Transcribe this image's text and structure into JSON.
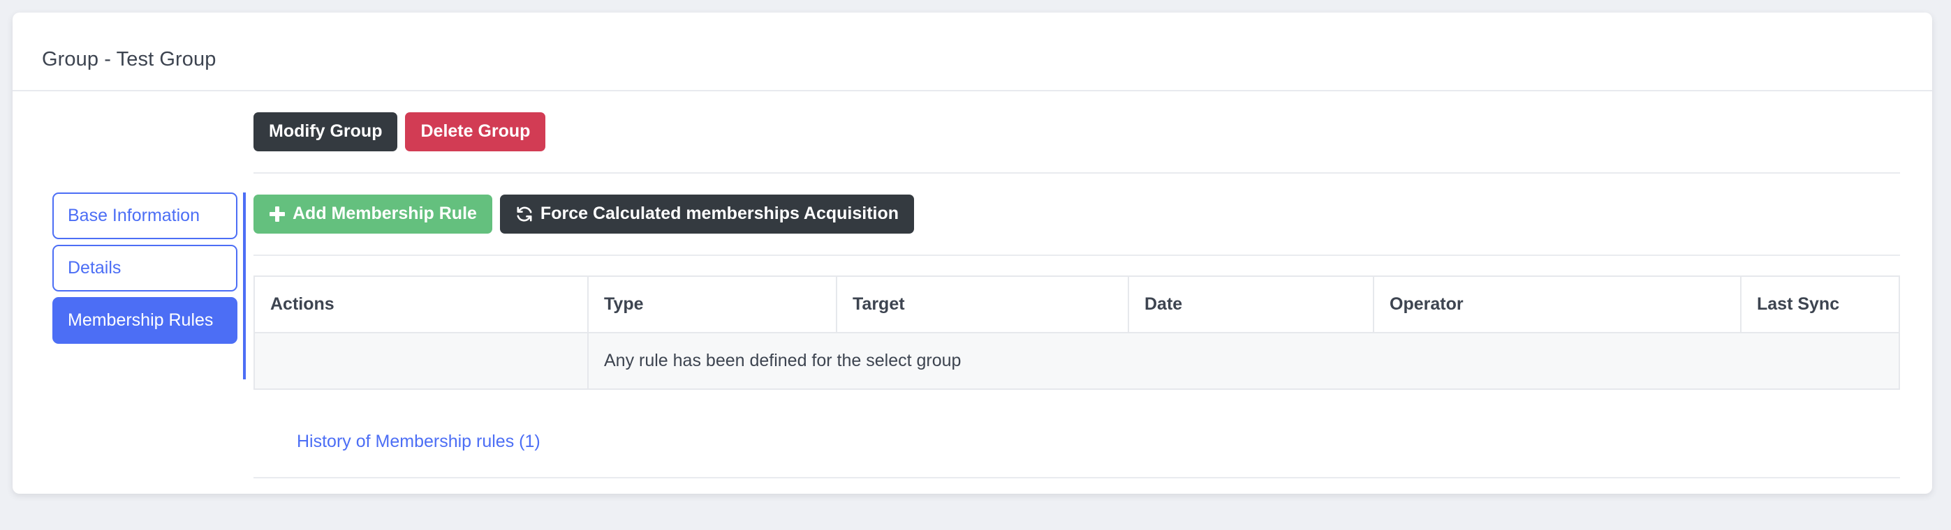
{
  "header": {
    "title": "Group - Test Group"
  },
  "group_actions": {
    "modify_label": "Modify Group",
    "delete_label": "Delete Group"
  },
  "rule_actions": {
    "add_label": "Add Membership Rule",
    "force_label": "Force Calculated memberships Acquisition",
    "add_icon": "plus-icon",
    "force_icon": "sync-icon"
  },
  "sidebar": {
    "items": [
      {
        "label": "Base Information",
        "active": false
      },
      {
        "label": "Details",
        "active": false
      },
      {
        "label": "Membership Rules",
        "active": true
      }
    ]
  },
  "table": {
    "columns": [
      "Actions",
      "Type",
      "Target",
      "Date",
      "Operator",
      "Last Sync"
    ],
    "empty_message": "Any rule has been defined for the select group"
  },
  "footer": {
    "history_link": "History of Membership rules (1)"
  },
  "colors": {
    "accent": "#4c6ef5",
    "dark": "#343a40",
    "danger": "#d23c54",
    "success": "#64c07e",
    "page_bg": "#eef0f4",
    "border": "#e6e8ec"
  }
}
